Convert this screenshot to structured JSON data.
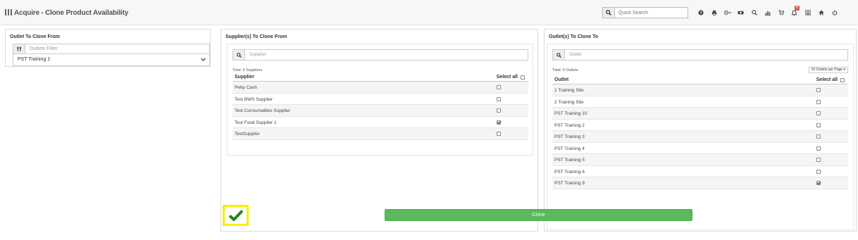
{
  "app": {
    "title": "Acquire - Clone Product Availability"
  },
  "header": {
    "search_placeholder": "Quick Search",
    "notification_count": "0",
    "icons": [
      "search-icon",
      "help-icon",
      "print-icon",
      "settings-icon",
      "video-icon",
      "search-icon",
      "chart-icon",
      "cart-icon",
      "notifications-icon",
      "list-icon",
      "home-icon",
      "power-icon"
    ]
  },
  "outlet_from": {
    "title": "Outlet To Clone From",
    "filter_placeholder": "Outlets Filter",
    "selected": "PST Training 1"
  },
  "suppliers": {
    "title": "Supplier(s) To Clone From",
    "search_placeholder": "Supplier",
    "total": "Total: 5 Suppliers",
    "col_header": "Supplier",
    "select_all": "Select all",
    "rows": [
      {
        "name": "Petty Cash",
        "checked": false
      },
      {
        "name": "Test BWS Supplier",
        "checked": false
      },
      {
        "name": "Test Consumables Supplier",
        "checked": false
      },
      {
        "name": "Test Food Supplier 1",
        "checked": true
      },
      {
        "name": "TestSupplier",
        "checked": false
      }
    ]
  },
  "outlets_to": {
    "title": "Outlet(s) To Clone To",
    "search_placeholder": "Outlet",
    "total": "Total: 9 Outlets",
    "per_page": "10 Outlets per Page",
    "col_header": "Outlet",
    "select_all": "Select all",
    "rows": [
      {
        "name": "1 Training Site",
        "checked": false
      },
      {
        "name": "2 Training Site",
        "checked": false
      },
      {
        "name": "PST Training 10",
        "checked": false
      },
      {
        "name": "PST Training 2",
        "checked": false
      },
      {
        "name": "PST Training 3",
        "checked": false
      },
      {
        "name": "PST Training 4",
        "checked": false
      },
      {
        "name": "PST Training 5",
        "checked": false
      },
      {
        "name": "PST Training 6",
        "checked": false
      },
      {
        "name": "PST Training 9",
        "checked": true
      }
    ]
  },
  "actions": {
    "clone_label": "Clone"
  },
  "colors": {
    "accent_green": "#5cb85c",
    "highlight_yellow": "#f5f000",
    "check_green": "#1a8a1a",
    "badge_red": "#d9534f"
  }
}
